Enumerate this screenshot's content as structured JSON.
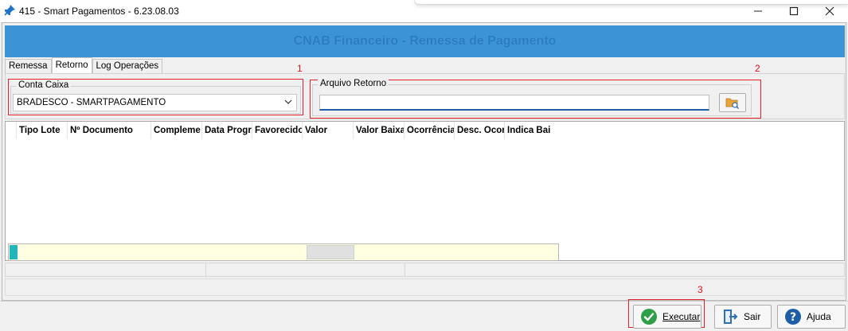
{
  "window": {
    "title": "415 - Smart Pagamentos - 6.23.08.03"
  },
  "banner": {
    "title": "CNAB Financeiro - Remessa de Pagamento"
  },
  "tabs": [
    {
      "label": "Remessa",
      "active": false
    },
    {
      "label": "Retorno",
      "active": true
    },
    {
      "label": "Log Operações",
      "active": false
    }
  ],
  "annotations": [
    "1",
    "2",
    "3"
  ],
  "conta_caixa": {
    "label": "Conta Caixa",
    "value": "BRADESCO - SMARTPAGAMENTO"
  },
  "arquivo_retorno": {
    "label": "Arquivo Retorno",
    "value": ""
  },
  "grid": {
    "columns": [
      "Tipo Lote",
      "Nº Documento",
      "Compleme",
      "Data Progr",
      "Favorecido",
      "Valor",
      "Valor Baixa",
      "Ocorrência",
      "Desc. Ocor",
      "Indica Bai"
    ]
  },
  "buttons": {
    "executar": "Executar",
    "sair": "Sair",
    "ajuda": "Ajuda"
  },
  "colors": {
    "banner": "#3c94d4",
    "annotation": "#e0212b",
    "scroll_bg": "#ffffe2"
  }
}
